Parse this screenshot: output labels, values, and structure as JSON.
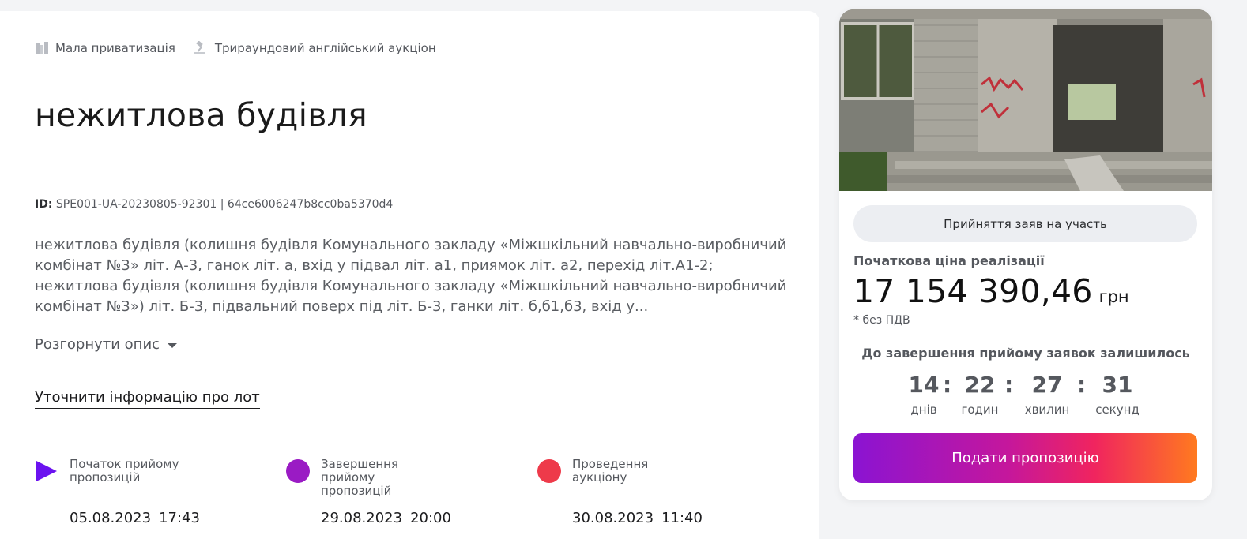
{
  "tags": [
    {
      "label": "Мала приватизація",
      "icon": "buildings-icon"
    },
    {
      "label": "Трираундовий англійський аукціон",
      "icon": "gavel-icon"
    }
  ],
  "title": "нежитлова будівля",
  "identifier": {
    "prefix": "ID:",
    "value": "SPE001-UA-20230805-92301 | 64ce6006247b8cc0ba5370d4"
  },
  "description": "нежитлова будівля (колишня будівля Комунального закладу «Міжшкільний навчально-виробничий комбінат №3» літ. А-3, ганок літ. а, вхід у підвал літ. а1, приямок літ. а2, перехід літ.А1-2; нежитлова будівля (колишня будівля Комунального закладу «Міжшкільний навчально-виробничий комбінат №3») літ. Б-3, підвальний поверх під літ. Б-3, ганки літ. б,б1,б3, вхід у...",
  "expand_label": "Розгорнути опис",
  "clarify_label": "Уточнити інформацію про лот",
  "timeline": [
    {
      "label": "Початок прийому пропозицій",
      "date": "05.08.2023",
      "time": "17:43",
      "color": "#6b12f0",
      "marker": "play-icon"
    },
    {
      "label": "Завершення прийому пропозицій",
      "date": "29.08.2023",
      "time": "20:00",
      "color": "#9a1bc4",
      "marker": "circle-icon"
    },
    {
      "label": "Проведення аукціону",
      "date": "30.08.2023",
      "time": "11:40",
      "color": "#ee3a4a",
      "marker": "circle-icon"
    }
  ],
  "side": {
    "status": "Прийняття заяв на участь",
    "price_label": "Початкова ціна реалізації",
    "price": "17 154 390,46",
    "currency": "грн",
    "vat_note": "* без ПДВ",
    "countdown_title": "До завершення прийому заявок залишилось",
    "countdown": [
      {
        "value": "14",
        "unit": "днів"
      },
      {
        "value": "22",
        "unit": "годин"
      },
      {
        "value": "27",
        "unit": "хвилин"
      },
      {
        "value": "31",
        "unit": "секунд"
      }
    ],
    "countdown_separator": ":",
    "submit_label": "Подати пропозицію"
  }
}
